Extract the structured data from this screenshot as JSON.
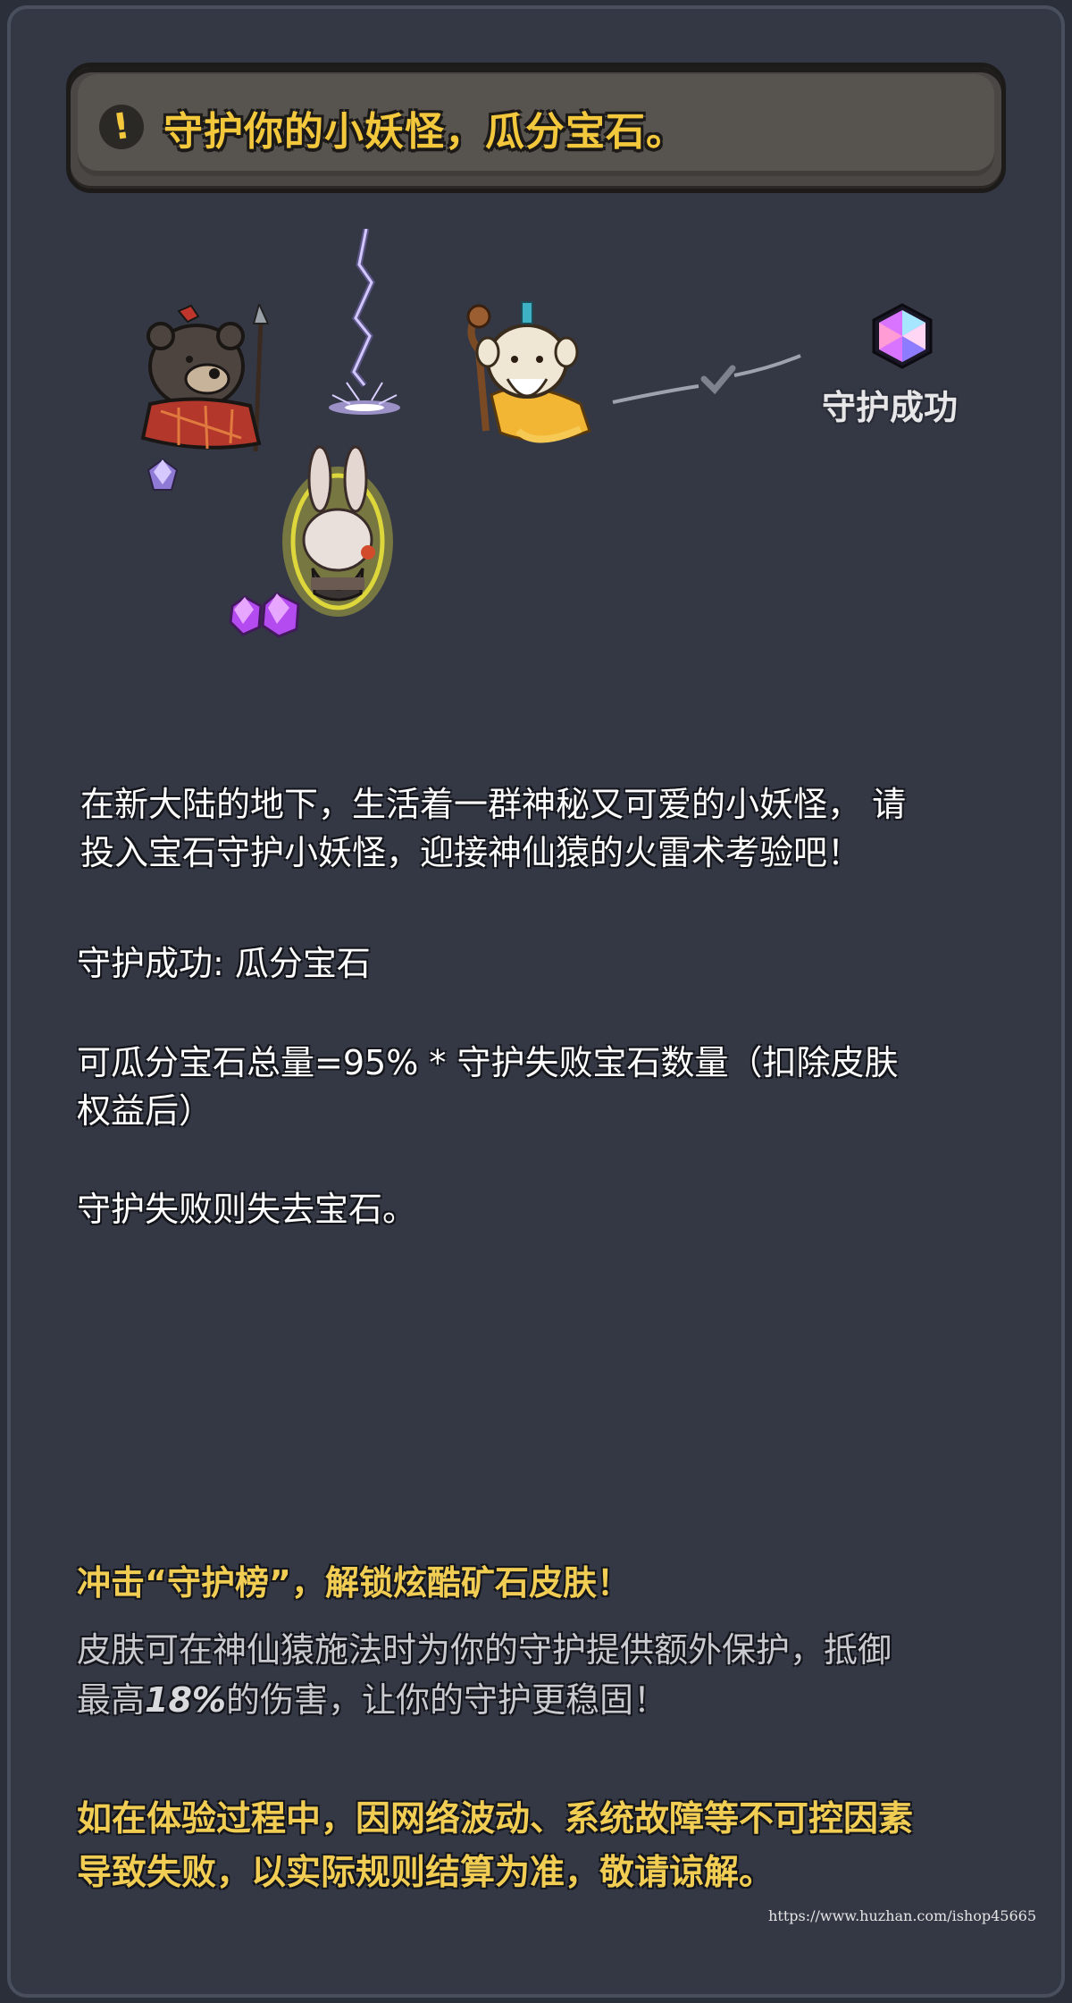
{
  "banner": {
    "icon": "exclamation-icon",
    "title": "守护你的小妖怪，瓜分宝石。"
  },
  "illustration": {
    "success_label": "守护成功"
  },
  "intro": {
    "line1": "在新大陆的地下，生活着一群神秘又可爱的小妖怪， 请",
    "line2": "投入宝石守护小妖怪，迎接神仙猿的火雷术考验吧！"
  },
  "rules": {
    "success": "守护成功: 瓜分宝石",
    "formula_line1": "可瓜分宝石总量=95% * 守护失败宝石数量（扣除皮肤",
    "formula_line2": "权益后）",
    "fail": "守护失败则失去宝石。"
  },
  "promo": {
    "title": "冲击“守护榜”，解锁炫酷矿石皮肤！",
    "desc_line1": "皮肤可在神仙猿施法时为你的守护提供额外保护，抵御",
    "desc_prefix": "最高",
    "desc_percent": "18%",
    "desc_suffix": "的伤害，让你的守护更稳固！"
  },
  "disclaimer": {
    "line1": "如在体验过程中，因网络波动、系统故障等不可控因素",
    "line2": "导致失败，以实际规则结算为准，敬请谅解。"
  },
  "watermark": "https://www.huzhan.com/ishop45665",
  "colors": {
    "background": "#343845",
    "accent_yellow": "#f4c83c",
    "banner": "#57534f"
  }
}
